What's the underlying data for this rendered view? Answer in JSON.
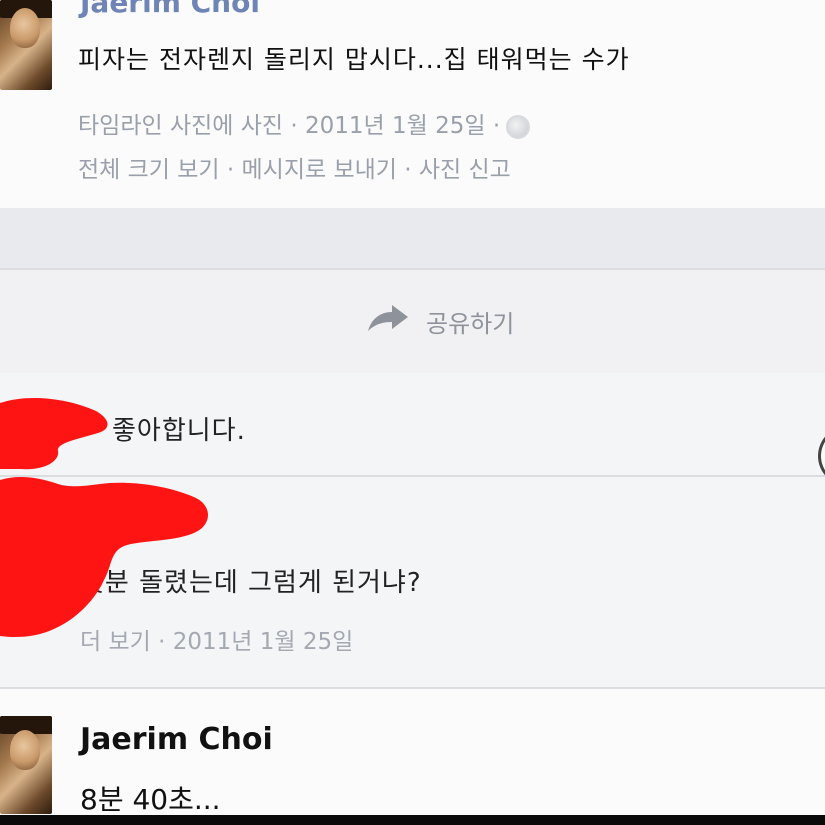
{
  "post": {
    "author": "Jaerim Choi",
    "text": "피자는 전자렌지 돌리지 맙시다...집 태워먹는 수가",
    "meta_line1": "타임라인 사진에 사진 · 2011년 1월 25일 ·",
    "meta_line2": "전체 크기 보기 · 메시지로 보내기 · 사진 신고",
    "privacy_icon": "globe-icon"
  },
  "share": {
    "label": "공유하기",
    "icon": "share-arrow-icon"
  },
  "likes": {
    "text": "좋아합니다."
  },
  "comment": {
    "text": "몇분 돌렸는데 그럼게 된거냐?",
    "meta": "더 보기 · 2011년 1월 25일"
  },
  "reply": {
    "author": "Jaerim Choi",
    "text": "8분 40초..."
  },
  "colors": {
    "link_blue": "#6d84b4",
    "meta_gray": "#9aa0ab",
    "censor_red": "#ff1414"
  }
}
